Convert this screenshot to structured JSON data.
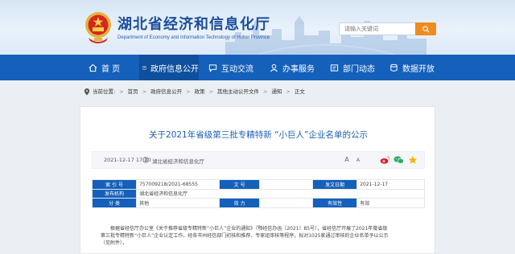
{
  "header": {
    "title": "湖北省经济和信息化厅",
    "subtitle": "Department of Economy and Information Technology of Hubei Province",
    "search_placeholder": "请输入关键词"
  },
  "nav": {
    "items": [
      {
        "label": "首 页",
        "icon": "home-icon"
      },
      {
        "label": "政府信息公开",
        "icon": "document-icon"
      },
      {
        "label": "互动交流",
        "icon": "chat-icon"
      },
      {
        "label": "办事服务",
        "icon": "service-icon"
      },
      {
        "label": "部门动态",
        "icon": "news-icon"
      },
      {
        "label": "数据开放",
        "icon": "data-icon"
      }
    ]
  },
  "breadcrumb": {
    "prefix": "当前位置:",
    "items": [
      "首页",
      "政府信息公开",
      "政策",
      "其他主动公开文件",
      "通知",
      "正文"
    ]
  },
  "article": {
    "title": "关于2021年省级第三批专精特新 “小巨人”企业名单的公示",
    "date": "2021-12-17 17:20",
    "source": "湖北省经济和信息化厅",
    "font_large": "A",
    "font_small": "A",
    "table": {
      "rows": [
        [
          {
            "k": "索 引 号",
            "v": "757009218/2021-68555"
          },
          {
            "k": "文 号",
            "v": ""
          },
          {
            "k": "发文日期",
            "v": "2021-12-17"
          }
        ],
        [
          {
            "k": "发布机构",
            "v": "湖北省经济和信息化厅"
          }
        ],
        [
          {
            "k": "分 类",
            "v": "其他"
          },
          {
            "k": "效 力",
            "v": ""
          },
          {
            "k": "有效性",
            "v": "有效"
          }
        ]
      ]
    },
    "body": [
      "根据省经信厅办公室《关于推荐省级专精特新“小巨人”企业的通知》（鄂经信办函〔2021〕85号），省经信厅开展了2021年度省级",
      "第三批专精特新“小巨人”企业认定工作。经各市州经信部门初核和推荐、专家组审核等程序，拟对1025家通过审核的企业名单予以公示",
      "（见附件）。"
    ]
  },
  "colors": {
    "brand_blue": "#1460ba",
    "title_blue": "#1b4e9b",
    "search_orange": "#f08b1e"
  }
}
